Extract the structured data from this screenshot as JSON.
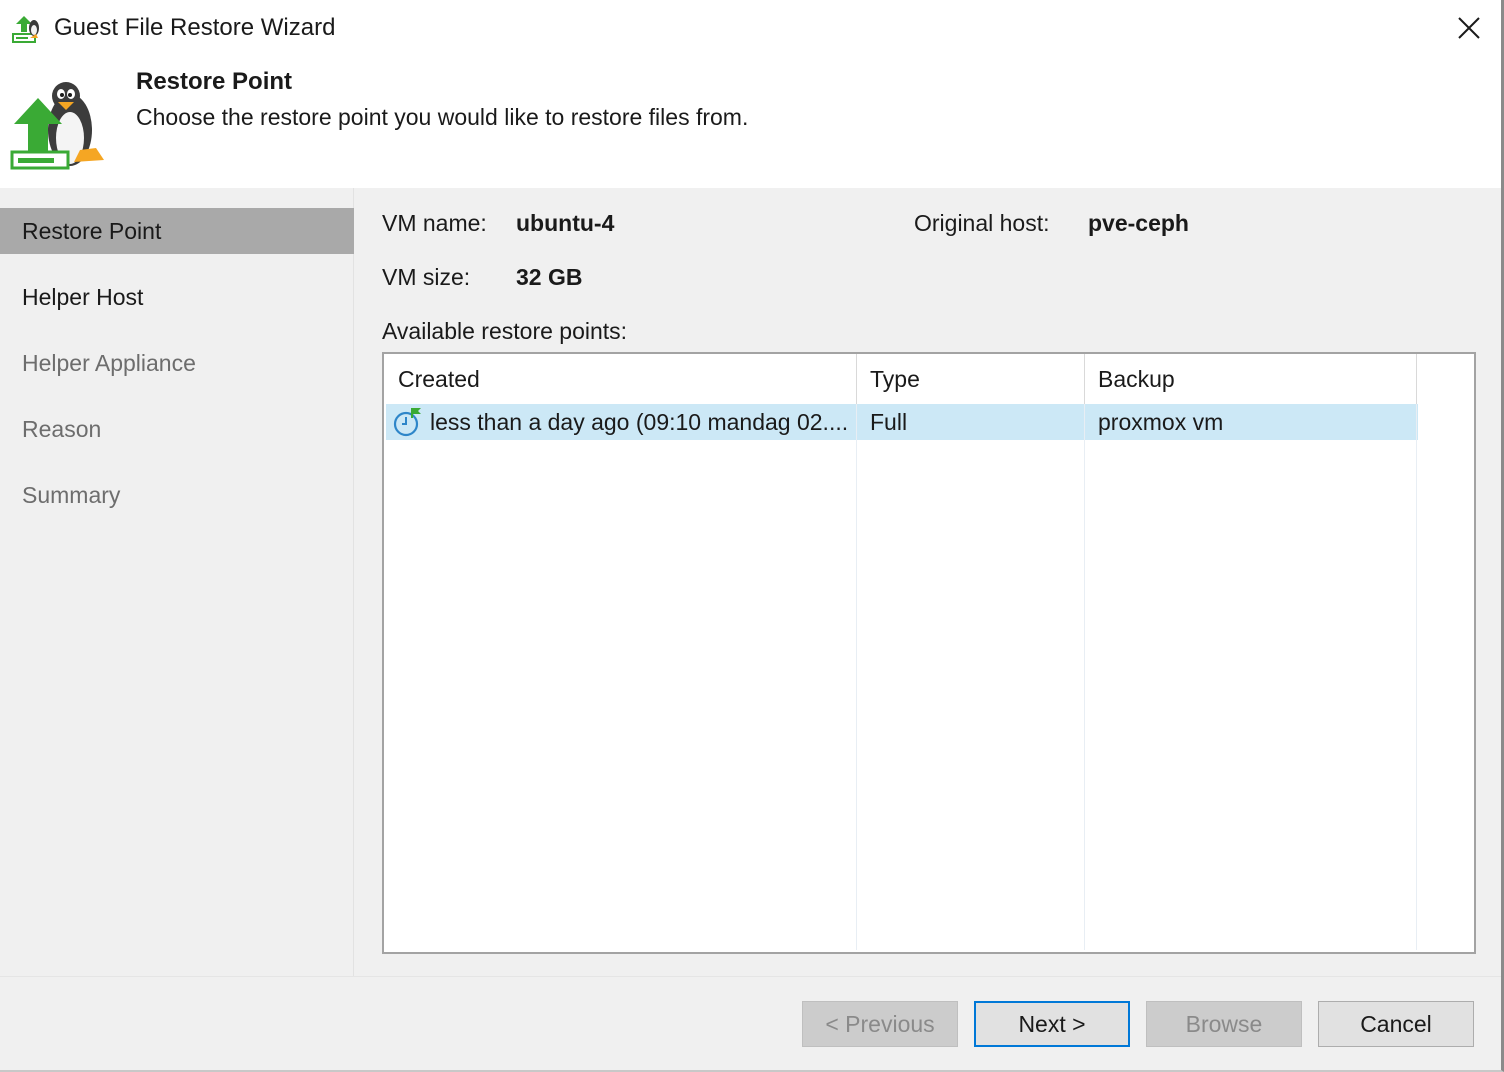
{
  "window": {
    "title": "Guest File Restore Wizard"
  },
  "header": {
    "title": "Restore Point",
    "subtitle": "Choose the restore point you would like to restore files from."
  },
  "steps": [
    {
      "label": "Restore Point",
      "state": "active"
    },
    {
      "label": "Helper Host",
      "state": "enabled"
    },
    {
      "label": "Helper Appliance",
      "state": "disabled"
    },
    {
      "label": "Reason",
      "state": "disabled"
    },
    {
      "label": "Summary",
      "state": "disabled"
    }
  ],
  "vm": {
    "name_label": "VM name:",
    "name_value": "ubuntu-4",
    "host_label": "Original host:",
    "host_value": "pve-ceph",
    "size_label": "VM size:",
    "size_value": "32 GB",
    "points_label": "Available restore points:"
  },
  "table": {
    "columns": [
      "Created",
      "Type",
      "Backup"
    ],
    "rows": [
      {
        "created": "less than a day ago (09:10 mandag 02....",
        "type": "Full",
        "backup": "proxmox vm",
        "selected": true,
        "icon": "restore-point-clock-icon"
      }
    ]
  },
  "buttons": {
    "previous": "< Previous",
    "next": "Next >",
    "browse": "Browse",
    "cancel": "Cancel"
  },
  "colors": {
    "accent": "#0078d7",
    "selection": "#cce8f6",
    "sidebar_active": "#a9a9a9",
    "icon_green": "#3aaa35"
  }
}
